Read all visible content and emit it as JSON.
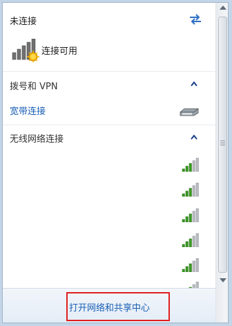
{
  "status": {
    "title": "未连接",
    "subtitle": "连接可用"
  },
  "sections": {
    "dialup": {
      "header": "拨号和 VPN",
      "item": "宽带连接"
    },
    "wireless": {
      "header": "无线网络连接"
    }
  },
  "wifi_networks": [
    {
      "signal_bars": 5
    },
    {
      "signal_bars": 5
    },
    {
      "signal_bars": 5
    },
    {
      "signal_bars": 5
    },
    {
      "signal_bars": 5
    },
    {
      "signal_bars": 5
    }
  ],
  "footer": {
    "link": "打开网络和共享中心"
  },
  "colors": {
    "link": "#1a5fb4",
    "signal_green": "#3a9a23",
    "highlight": "#e01e1e"
  },
  "icons": [
    "network-status-icon",
    "refresh-icon",
    "collapse-chevron-icon",
    "modem-icon",
    "wifi-signal-icon"
  ]
}
